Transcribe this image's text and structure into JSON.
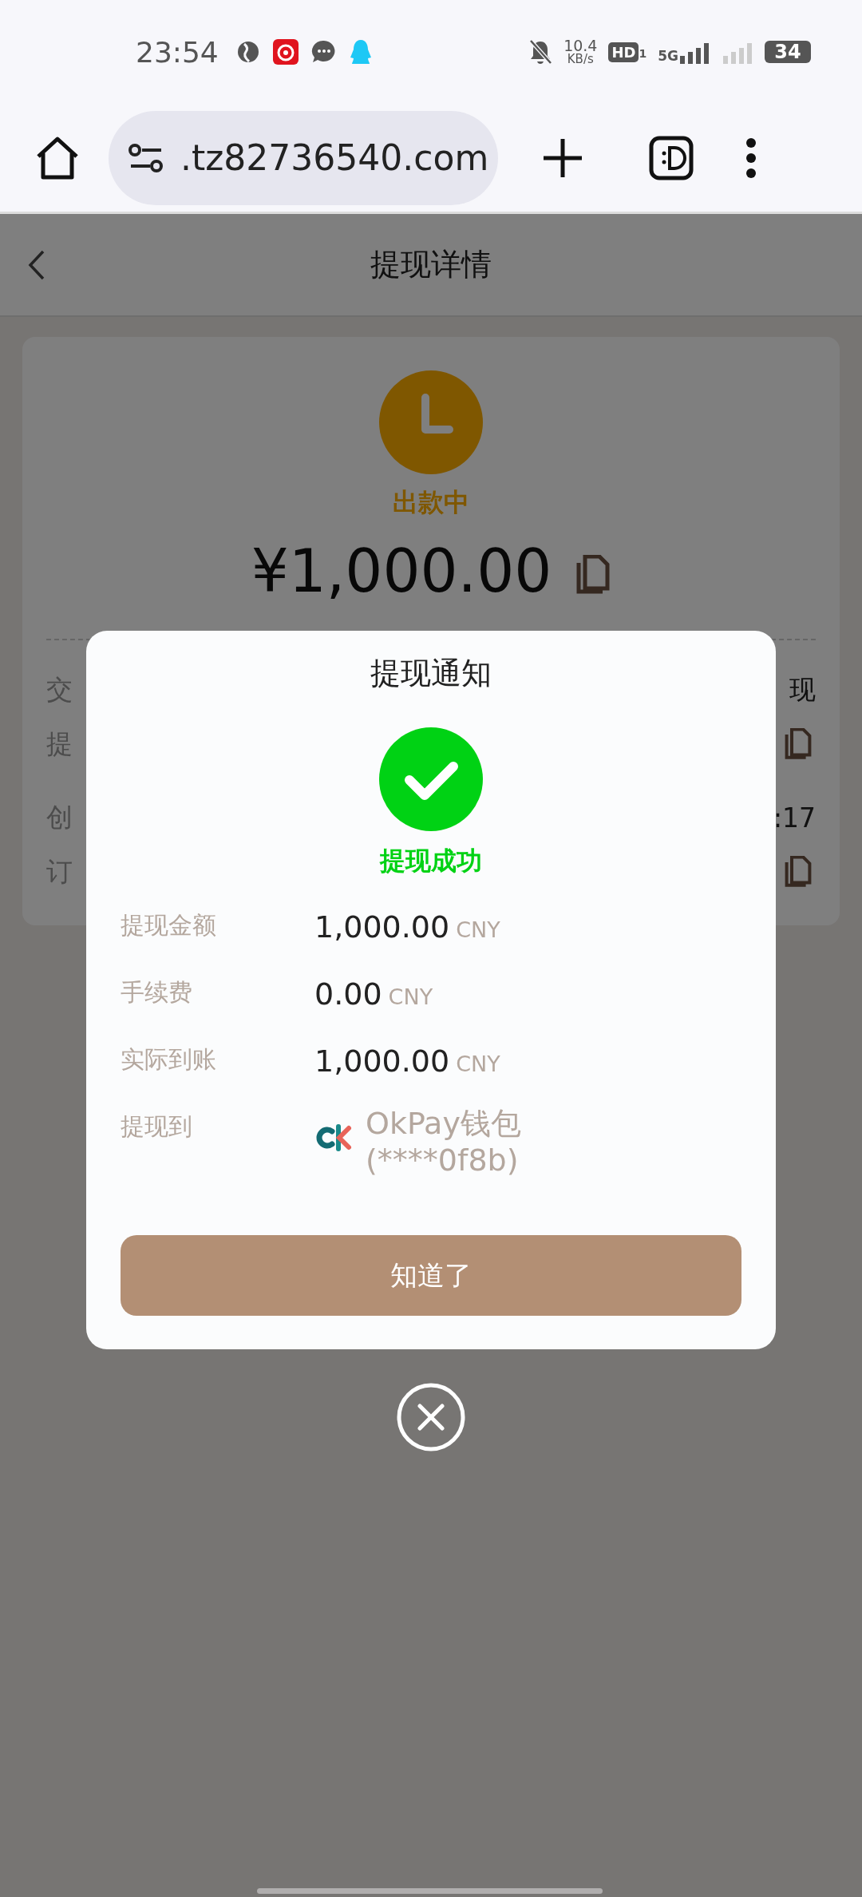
{
  "status_bar": {
    "time": "23:54",
    "speed": "10.4",
    "speed_unit": "KB/s",
    "hd": "HD",
    "hd_sub": "1",
    "network": "5G",
    "battery": "34"
  },
  "browser": {
    "url": ".tz82736540.com"
  },
  "header": {
    "title": "提现详情"
  },
  "card": {
    "status": {
      "text": "出款中",
      "kind": "pending"
    },
    "amount": "¥1,000.00",
    "rows": [
      {
        "label": "交",
        "value": "现",
        "kind": "text"
      },
      {
        "label": "提",
        "kind": "copy"
      },
      {
        "label": "创",
        "value": ":17",
        "kind": "text"
      },
      {
        "label": "订",
        "kind": "copy"
      }
    ]
  },
  "dialog": {
    "title": "提现通知",
    "result": {
      "text": "提现成功",
      "kind": "success"
    },
    "details": [
      {
        "label": "提现金额",
        "value": "1,000.00",
        "unit": "CNY"
      },
      {
        "label": "手续费",
        "value": "0.00",
        "unit": "CNY"
      },
      {
        "label": "实际到账",
        "value": "1,000.00",
        "unit": "CNY"
      }
    ],
    "destination": {
      "label": "提现到",
      "name": "OkPay钱包",
      "account": "(****0f8b)"
    },
    "button": "知道了"
  }
}
